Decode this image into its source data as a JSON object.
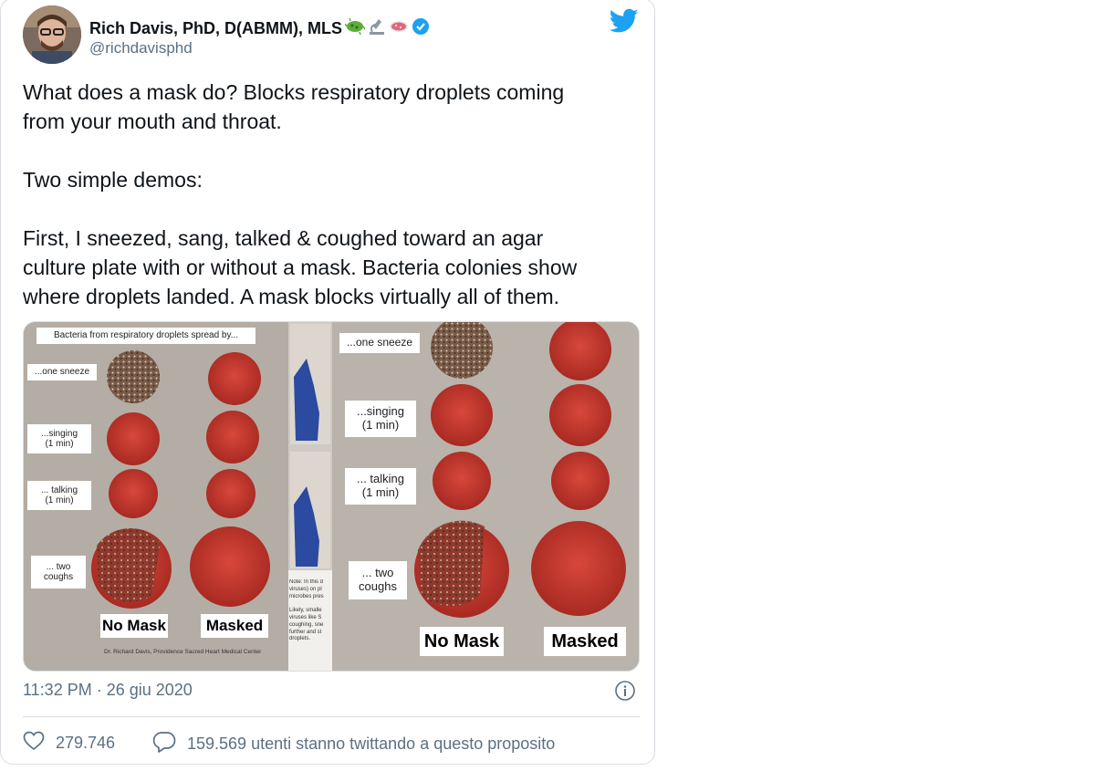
{
  "author": {
    "name": "Rich Davis, PhD, D(ABMM), MLS",
    "handle": "@richdavisphd",
    "badges": [
      "microbe-emoji",
      "microscope-emoji",
      "petri-dish-emoji",
      "verified-badge"
    ]
  },
  "platform_icon": "twitter-bird-icon",
  "tweet": {
    "paragraphs": [
      "What does a mask do? Blocks respiratory droplets coming\nfrom your mouth and throat.",
      "Two simple demos:",
      "First, I sneezed, sang, talked & coughed toward an agar\nculture plate with or without a mask. Bacteria colonies show\nwhere droplets landed. A mask blocks virtually all of them."
    ]
  },
  "media": {
    "left_panel": {
      "header": "Bacteria from respiratory droplets spread by...",
      "rows": [
        "...one sneeze",
        "...singing\n(1 min)",
        "... talking\n(1 min)",
        "... two\ncoughs"
      ],
      "col_labels": [
        "No Mask",
        "Masked"
      ],
      "credit": "Dr. Richard Davis, Providence Sacred Heart Medical Center"
    },
    "middle_note": "Note: In this d\nviruses) on pl\nmicrobes pres\n\nLikely, smalle\nviruses like S\ncoughing, sne\nfurther and st\ndroplets.",
    "right_panel": {
      "rows": [
        "...one sneeze",
        "...singing\n(1 min)",
        "... talking\n(1 min)",
        "... two\ncoughs"
      ],
      "col_labels": [
        "No Mask",
        "Masked"
      ]
    }
  },
  "meta": {
    "timestamp": "11:32 PM · 26 giu 2020"
  },
  "actions": {
    "likes": "279.746",
    "replies_text": "159.569 utenti stanno twittando a questo proposito"
  },
  "colors": {
    "twitter_blue": "#1da1f2",
    "secondary_text": "#5b7083",
    "agar_red": "#c4342c"
  }
}
